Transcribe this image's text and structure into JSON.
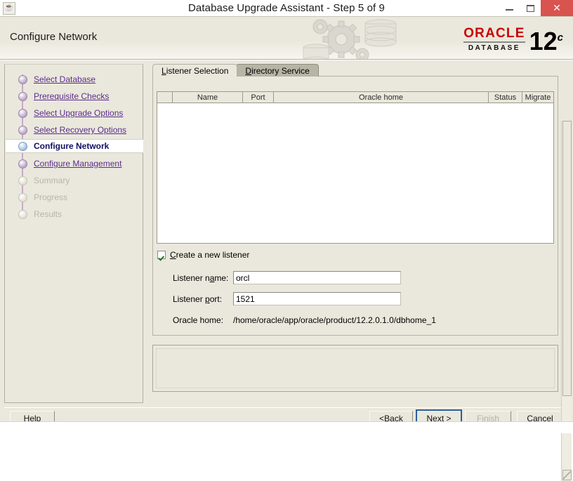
{
  "window": {
    "title": "Database Upgrade Assistant - Step 5 of 9",
    "app_icon": "java-coffee-cup-icon",
    "controls": {
      "minimize": "–",
      "maximize": "□",
      "close": "✕"
    }
  },
  "banner": {
    "title": "Configure Network",
    "logo": {
      "brand": "ORACLE",
      "product": "DATABASE",
      "version": "12",
      "version_sup": "c"
    }
  },
  "sidebar": {
    "items": [
      {
        "label": "Select Database",
        "state": "done"
      },
      {
        "label": "Prerequisite Checks",
        "state": "done"
      },
      {
        "label": "Select Upgrade Options",
        "state": "done"
      },
      {
        "label": "Select Recovery Options",
        "state": "done"
      },
      {
        "label": "Configure Network",
        "state": "current"
      },
      {
        "label": "Configure Management",
        "state": "done"
      },
      {
        "label": "Summary",
        "state": "todo"
      },
      {
        "label": "Progress",
        "state": "todo"
      },
      {
        "label": "Results",
        "state": "todo"
      }
    ]
  },
  "tabs": [
    {
      "label": "Listener Selection",
      "mnemonic": "L",
      "active": true
    },
    {
      "label": "Directory Service",
      "mnemonic": "D",
      "active": false
    }
  ],
  "table": {
    "columns": [
      "",
      "Name",
      "Port",
      "Oracle home",
      "Status",
      "Migrate"
    ],
    "rows": []
  },
  "form": {
    "create_listener": {
      "label_pre": "",
      "mnemonic": "C",
      "label_post": "reate a new listener",
      "checked": true
    },
    "listener_name": {
      "label_pre": "Listener n",
      "mnemonic": "a",
      "label_post": "me:",
      "value": "orcl"
    },
    "listener_port": {
      "label_pre": "Listener ",
      "mnemonic": "p",
      "label_post": "ort:",
      "value": "1521"
    },
    "oracle_home": {
      "label": "Oracle home:",
      "value": "/home/oracle/app/oracle/product/12.2.0.1.0/dbhome_1"
    }
  },
  "footer": {
    "help": {
      "pre": "H",
      "mnemonic": "e",
      "post": "lp"
    },
    "back": {
      "pre": "< ",
      "mnemonic": "B",
      "post": "ack"
    },
    "next": {
      "pre": "",
      "mnemonic": "N",
      "post": "ext >"
    },
    "finish": {
      "pre": "",
      "mnemonic": "F",
      "post": "inish",
      "disabled": true
    },
    "cancel": {
      "pre": "",
      "mnemonic": "C",
      "post": "ancel"
    }
  },
  "colors": {
    "background": "#eae8dc",
    "link": "#5b2d8e",
    "active_text": "#101060",
    "disabled_text": "#b8b6a8",
    "oracle_red": "#cc0000",
    "close_red": "#d9534f",
    "focus_blue": "#2b5f9e"
  }
}
